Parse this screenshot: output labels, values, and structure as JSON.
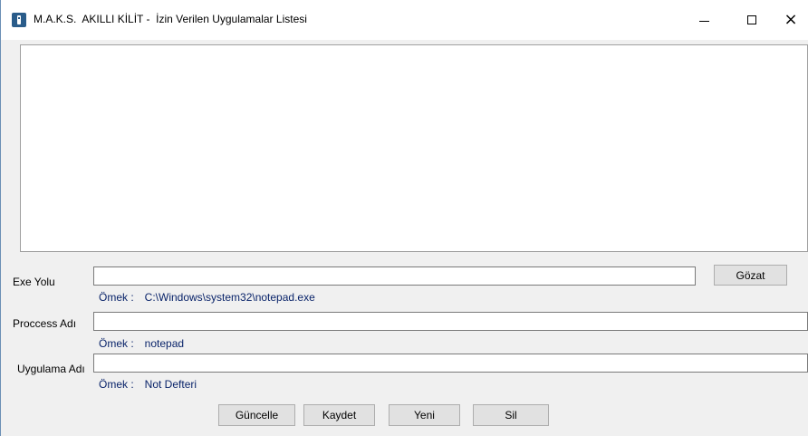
{
  "window": {
    "title": "M.A.K.S.  AKILLI KİLİT -  İzin Verilen Uygulamalar Listesi",
    "icon": "lock-app-icon",
    "controls": {
      "minimize": "minimize-icon",
      "maximize": "maximize-icon",
      "close": "×"
    }
  },
  "form": {
    "exe_path": {
      "label": "Exe Yolu",
      "value": "",
      "browse_label": "Gözat",
      "example_prefix": "Ömek :",
      "example_value": "C:\\Windows\\system32\\notepad.exe"
    },
    "process_name": {
      "label": "Proccess Adı",
      "value": "",
      "example_prefix": "Ömek :",
      "example_value": "notepad"
    },
    "app_name": {
      "label": "Uygulama Adı",
      "value": "",
      "example_prefix": "Ömek :",
      "example_value": "Not Defteri"
    }
  },
  "actions": {
    "update_label": "Güncelle",
    "save_label": "Kaydet",
    "new_label": "Yeni",
    "delete_label": "Sil"
  },
  "colors": {
    "example_text": "#0a246a",
    "button_face": "#e1e1e1",
    "window_border": "#6b8fb5"
  }
}
